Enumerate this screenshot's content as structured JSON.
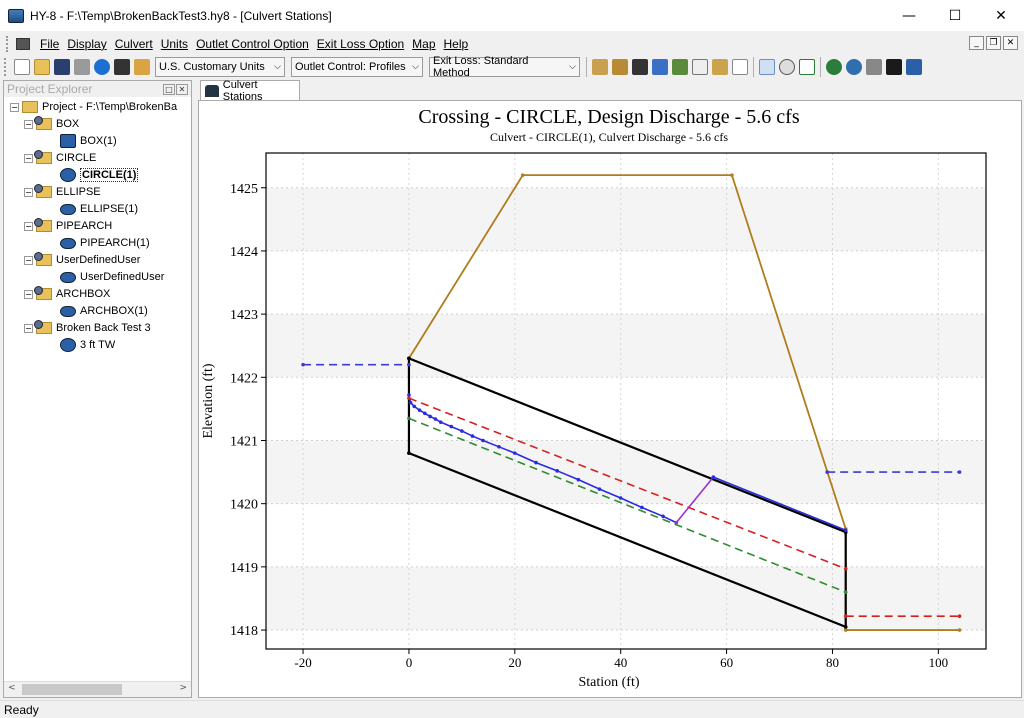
{
  "window": {
    "title": "HY-8 - F:\\Temp\\BrokenBackTest3.hy8 - [Culvert Stations]",
    "minimize": "—",
    "maximize": "☐",
    "close": "✕"
  },
  "menu": {
    "items": [
      "File",
      "Display",
      "Culvert",
      "Units",
      "Outlet Control Option",
      "Exit Loss Option",
      "Map",
      "Help"
    ],
    "mdi_min": "_",
    "mdi_restore": "❐",
    "mdi_close": "✕"
  },
  "toolbar": {
    "units": "U.S. Customary Units",
    "outlet_control": "Outlet Control: Profiles",
    "exit_loss": "Exit Loss: Standard Method"
  },
  "explorer": {
    "title": "Project Explorer",
    "root": "Project - F:\\Temp\\BrokenBa",
    "crossings": [
      {
        "name": "BOX",
        "culvert": "BOX(1)"
      },
      {
        "name": "CIRCLE",
        "culvert": "CIRCLE(1)"
      },
      {
        "name": "ELLIPSE",
        "culvert": "ELLIPSE(1)"
      },
      {
        "name": "PIPEARCH",
        "culvert": "PIPEARCH(1)"
      },
      {
        "name": "UserDefinedUser",
        "culvert": "UserDefinedUser"
      },
      {
        "name": "ARCHBOX",
        "culvert": "ARCHBOX(1)"
      },
      {
        "name": "Broken Back Test 3",
        "culvert": "3 ft TW"
      }
    ]
  },
  "tab": {
    "label": "Culvert Stations"
  },
  "status": "Ready",
  "colors": {
    "embankment": "#b07d1e",
    "culvert": "#000000",
    "water_surface": "#2a2ae0",
    "hydraulic_jump": "#9b30d9",
    "critical_depth": "#d62020",
    "normal_depth": "#2e8b2e",
    "headwater_tailwater": "#3b3bd6"
  },
  "chart_data": {
    "type": "line",
    "title": "Crossing - CIRCLE, Design Discharge - 5.6 cfs",
    "subtitle": "Culvert - CIRCLE(1), Culvert Discharge - 5.6 cfs",
    "xlabel": "Station (ft)",
    "ylabel": "Elevation (ft)",
    "xlim": [
      -27,
      109
    ],
    "ylim": [
      1417.7,
      1425.55
    ],
    "xticks": [
      -20,
      0,
      20,
      40,
      60,
      80,
      100
    ],
    "yticks": [
      1418,
      1419,
      1420,
      1421,
      1422,
      1423,
      1424,
      1425
    ],
    "grid": "horizontal bands",
    "series": [
      {
        "key": "embankment",
        "color": "#b07d1e",
        "dash": "",
        "x": [
          0,
          21.5,
          61,
          82.5,
          82.5,
          104
        ],
        "y": [
          1422.3,
          1425.2,
          1425.2,
          1419.6,
          1418.0,
          1418.0
        ]
      },
      {
        "key": "culvert_top",
        "color": "#000000",
        "dash": "",
        "x": [
          0,
          82.5
        ],
        "y": [
          1422.3,
          1419.55
        ]
      },
      {
        "key": "culvert_bottom",
        "color": "#000000",
        "dash": "",
        "x": [
          0,
          82.5
        ],
        "y": [
          1420.8,
          1418.05
        ]
      },
      {
        "key": "culvert_inlet",
        "color": "#000000",
        "dash": "",
        "x": [
          0,
          0
        ],
        "y": [
          1420.8,
          1422.3
        ]
      },
      {
        "key": "culvert_outlet",
        "color": "#000000",
        "dash": "",
        "x": [
          82.5,
          82.5
        ],
        "y": [
          1418.05,
          1419.55
        ]
      },
      {
        "key": "water_surface",
        "color": "#2a2ae0",
        "dash": "",
        "x": [
          0,
          0.3,
          1,
          2,
          3,
          4,
          5,
          6,
          8,
          10,
          12,
          14,
          17,
          20,
          24,
          28,
          32,
          36,
          40,
          44,
          48,
          50.5
        ],
        "y": [
          1421.72,
          1421.6,
          1421.54,
          1421.48,
          1421.43,
          1421.38,
          1421.34,
          1421.29,
          1421.22,
          1421.15,
          1421.07,
          1421.0,
          1420.9,
          1420.8,
          1420.65,
          1420.52,
          1420.38,
          1420.23,
          1420.09,
          1419.94,
          1419.8,
          1419.7
        ]
      },
      {
        "key": "hydraulic_jump",
        "color": "#9b30d9",
        "dash": "",
        "x": [
          50.5,
          57.5
        ],
        "y": [
          1419.7,
          1420.42
        ]
      },
      {
        "key": "water_surface_downstream",
        "color": "#2a2ae0",
        "dash": "",
        "x": [
          57.5,
          82.5
        ],
        "y": [
          1420.42,
          1419.58
        ]
      },
      {
        "key": "critical_depth",
        "color": "#d62020",
        "dash": "8 5",
        "x": [
          0,
          82.5
        ],
        "y": [
          1421.67,
          1418.97
        ]
      },
      {
        "key": "normal_depth",
        "color": "#2e8b2e",
        "dash": "8 5",
        "x": [
          0,
          82.5
        ],
        "y": [
          1421.35,
          1418.6
        ]
      },
      {
        "key": "headwater",
        "color": "#3b3bd6",
        "dash": "8 5",
        "x": [
          -20,
          0
        ],
        "y": [
          1422.2,
          1422.2
        ]
      },
      {
        "key": "tailwater",
        "color": "#3b3bd6",
        "dash": "8 5",
        "x": [
          79,
          104
        ],
        "y": [
          1420.5,
          1420.5
        ]
      },
      {
        "key": "tailwater_critical",
        "color": "#d62020",
        "dash": "8 5",
        "x": [
          82.5,
          104
        ],
        "y": [
          1418.22,
          1418.22
        ]
      }
    ]
  }
}
